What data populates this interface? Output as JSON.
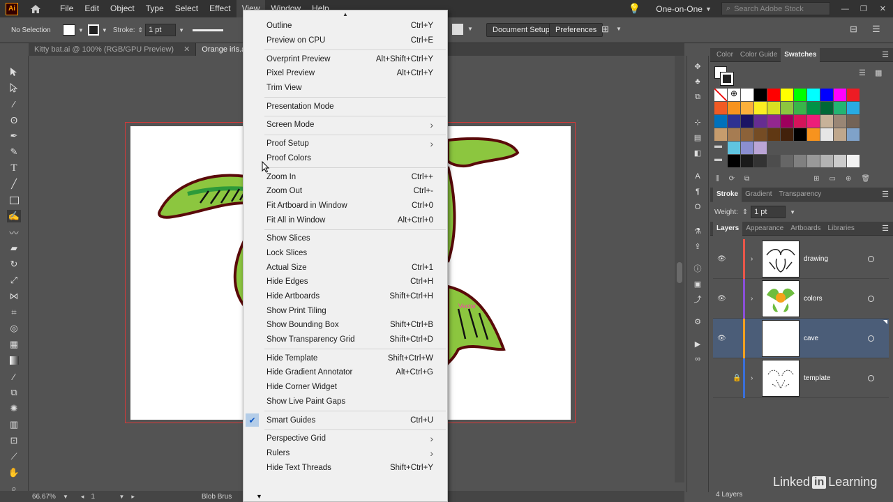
{
  "app": {
    "logo_text": "Ai"
  },
  "menubar": {
    "items": [
      "File",
      "Edit",
      "Object",
      "Type",
      "Select",
      "Effect",
      "View",
      "Window",
      "Help"
    ],
    "workspace": "One-on-One",
    "search_placeholder": "Search Adobe Stock"
  },
  "control_bar": {
    "selection": "No Selection",
    "stroke_label": "Stroke:",
    "stroke_value": "1 pt",
    "document_setup": "Document Setup",
    "preferences": "Preferences"
  },
  "tabs": [
    {
      "label": "Kitty bat.ai @ 100% (RGB/GPU Preview)",
      "active": false
    },
    {
      "label": "Orange iris.ai*",
      "active": true
    }
  ],
  "status_bar": {
    "zoom": "66.67%",
    "artboard": "1",
    "tool": "Blob Brus"
  },
  "canvas": {
    "pink_label": "Vector"
  },
  "view_menu": {
    "groups": [
      [
        {
          "label": "Outline",
          "shortcut": "Ctrl+Y"
        },
        {
          "label": "Preview on CPU",
          "shortcut": "Ctrl+E"
        }
      ],
      [
        {
          "label": "Overprint Preview",
          "shortcut": "Alt+Shift+Ctrl+Y"
        },
        {
          "label": "Pixel Preview",
          "shortcut": "Alt+Ctrl+Y"
        },
        {
          "label": "Trim View",
          "shortcut": ""
        }
      ],
      [
        {
          "label": "Presentation Mode",
          "shortcut": ""
        }
      ],
      [
        {
          "label": "Screen Mode",
          "shortcut": "",
          "submenu": true
        }
      ],
      [
        {
          "label": "Proof Setup",
          "shortcut": "",
          "submenu": true
        },
        {
          "label": "Proof Colors",
          "shortcut": ""
        }
      ],
      [
        {
          "label": "Zoom In",
          "shortcut": "Ctrl++"
        },
        {
          "label": "Zoom Out",
          "shortcut": "Ctrl+-"
        },
        {
          "label": "Fit Artboard in Window",
          "shortcut": "Ctrl+0"
        },
        {
          "label": "Fit All in Window",
          "shortcut": "Alt+Ctrl+0"
        }
      ],
      [
        {
          "label": "Show Slices",
          "shortcut": ""
        },
        {
          "label": "Lock Slices",
          "shortcut": ""
        },
        {
          "label": "Actual Size",
          "shortcut": "Ctrl+1"
        },
        {
          "label": "Hide Edges",
          "shortcut": "Ctrl+H"
        },
        {
          "label": "Hide Artboards",
          "shortcut": "Shift+Ctrl+H"
        },
        {
          "label": "Show Print Tiling",
          "shortcut": ""
        },
        {
          "label": "Show Bounding Box",
          "shortcut": "Shift+Ctrl+B"
        },
        {
          "label": "Show Transparency Grid",
          "shortcut": "Shift+Ctrl+D"
        }
      ],
      [
        {
          "label": "Hide Template",
          "shortcut": "Shift+Ctrl+W"
        },
        {
          "label": "Hide Gradient Annotator",
          "shortcut": "Alt+Ctrl+G"
        },
        {
          "label": "Hide Corner Widget",
          "shortcut": ""
        },
        {
          "label": "Show Live Paint Gaps",
          "shortcut": ""
        }
      ],
      [
        {
          "label": "Smart Guides",
          "shortcut": "Ctrl+U",
          "checked": true
        }
      ],
      [
        {
          "label": "Perspective Grid",
          "shortcut": "",
          "submenu": true
        },
        {
          "label": "Rulers",
          "shortcut": "",
          "submenu": true
        },
        {
          "label": "Hide Text Threads",
          "shortcut": "Shift+Ctrl+Y"
        }
      ]
    ]
  },
  "swatches_panel": {
    "tabs": [
      "Color",
      "Color Guide",
      "Swatches"
    ],
    "active_tab": "Swatches"
  },
  "stroke_panel": {
    "tabs": [
      "Stroke",
      "Gradient",
      "Transparency"
    ],
    "weight_label": "Weight:",
    "weight_value": "1 pt"
  },
  "layers_panel": {
    "tabs": [
      "Layers",
      "Appearance",
      "Artboards",
      "Libraries"
    ],
    "layers": [
      {
        "name": "drawing",
        "color": "#e8574a",
        "visible": true,
        "locked": false,
        "selected": false
      },
      {
        "name": "colors",
        "color": "#8a4fd8",
        "visible": true,
        "locked": false,
        "selected": false
      },
      {
        "name": "cave",
        "color": "#f0a020",
        "visible": true,
        "locked": false,
        "selected": true
      },
      {
        "name": "template",
        "color": "#3a6fd8",
        "visible": false,
        "locked": true,
        "selected": false
      }
    ],
    "count_label": "4 Layers"
  },
  "watermark": {
    "prefix": "Linked",
    "badge": "in",
    "suffix": "Learning"
  }
}
